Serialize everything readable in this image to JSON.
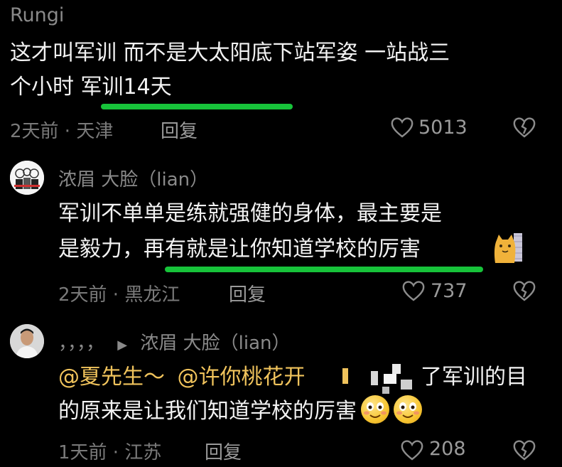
{
  "colors": {
    "background": "#000000",
    "underline_green": "#17c33a",
    "mention": "#f0c35c"
  },
  "comments": [
    {
      "username": "Rungi",
      "text_line1": "这才叫军训 而不是大太阳底下站军姿 一站战三",
      "text_line2": "个小时 军训14天",
      "meta": "2天前 · 天津",
      "reply_label": "回复",
      "likes": "5013",
      "avatar": "none"
    },
    {
      "username": "浓眉   大脸（lian）",
      "text_line1": "军训不单单是练就强健的身体，最主要是",
      "text_line2": "是毅力，再有就是让你知道学校的厉害",
      "sticker": "cat-sticker",
      "meta": "2天前 · 黑龙江",
      "reply_label": "回复",
      "likes": "737",
      "avatar": "cartoon-avatar"
    },
    {
      "reply_prefix": "，，，，",
      "reply_arrow": "▶",
      "reply_to": "浓眉   大脸（lian）",
      "mention1": "@夏先生～",
      "mention2": "@许你桃花开",
      "text_line1_tail": "了军训的目",
      "text_line2": "的原来是让我们知道学校的厉害",
      "emoji": "smile-emoji",
      "meta": "1天前 · 江苏",
      "reply_label": "回复",
      "likes": "208",
      "avatar": "photo-avatar"
    }
  ],
  "icons": {
    "like": "heart-outline-icon",
    "dislike": "broken-heart-icon"
  }
}
